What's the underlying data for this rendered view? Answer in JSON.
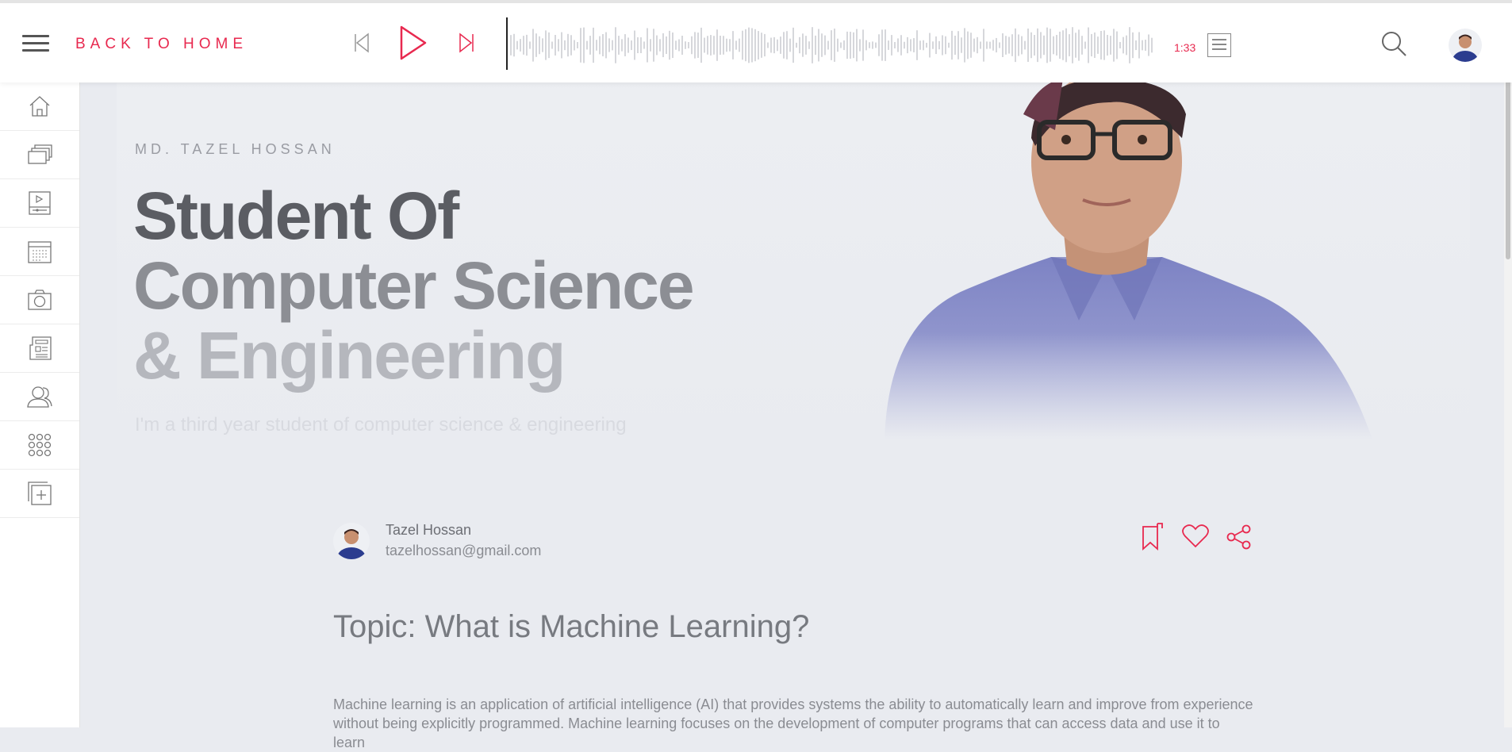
{
  "header": {
    "back_label": "BACK TO HOME",
    "time": "1:33"
  },
  "sidebar": {
    "items": [
      {
        "icon": "home-icon"
      },
      {
        "icon": "gallery-icon"
      },
      {
        "icon": "video-player-icon"
      },
      {
        "icon": "calendar-icon"
      },
      {
        "icon": "camera-icon"
      },
      {
        "icon": "newspaper-icon"
      },
      {
        "icon": "users-icon"
      },
      {
        "icon": "apps-grid-icon"
      },
      {
        "icon": "add-page-icon"
      }
    ]
  },
  "hero": {
    "name": "MD. TAZEL HOSSAN",
    "title_line1": "Student Of",
    "title_line2": "Computer Science",
    "title_line3": "& Engineering",
    "subtitle": "I'm a third year student of computer science & engineering"
  },
  "author": {
    "name": "Tazel Hossan",
    "email": "tazelhossan@gmail.com"
  },
  "post": {
    "topic": "Topic: What is Machine Learning?",
    "body": "Machine learning is an application of artificial intelligence (AI) that provides systems the ability to automatically learn and improve from experience without being explicitly programmed. Machine learning focuses on the development of computer programs that can access data and use it to learn"
  },
  "colors": {
    "accent": "#e8294f",
    "background": "#e9ebf0"
  }
}
